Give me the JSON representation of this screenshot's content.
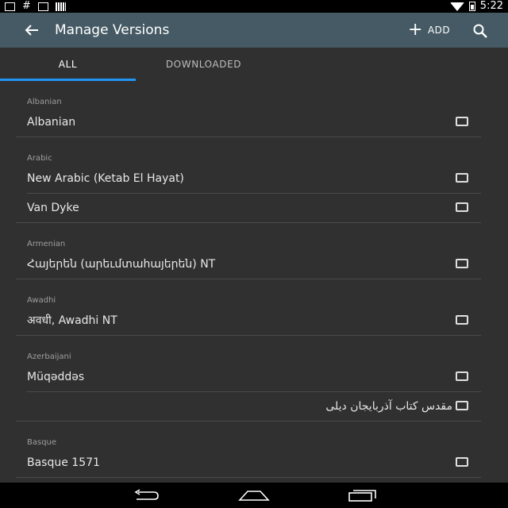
{
  "status_bar": {
    "time": "5:22"
  },
  "app_bar": {
    "title": "Manage Versions",
    "add_label": "ADD"
  },
  "tabs": [
    {
      "label": "ALL",
      "selected": true
    },
    {
      "label": "DOWNLOADED",
      "selected": false
    }
  ],
  "groups": [
    {
      "language": "Albanian",
      "versions": [
        "Albanian"
      ]
    },
    {
      "language": "Arabic",
      "versions": [
        "New Arabic (Ketab El Hayat)",
        "Van Dyke"
      ]
    },
    {
      "language": "Armenian",
      "versions": [
        "Հայերեն (արեւմտահայերեն) NT"
      ]
    },
    {
      "language": "Awadhi",
      "versions": [
        "अवधी, Awadhi NT"
      ]
    },
    {
      "language": "Azerbaijani",
      "versions": [
        "Müqəddəs",
        "مقدس کتاب آذربایجان دیلی"
      ]
    },
    {
      "language": "Basque",
      "versions": [
        "Basque 1571"
      ]
    }
  ],
  "colors": {
    "app_bar": "#455a64",
    "accent": "#2196f3",
    "background": "#303030"
  }
}
